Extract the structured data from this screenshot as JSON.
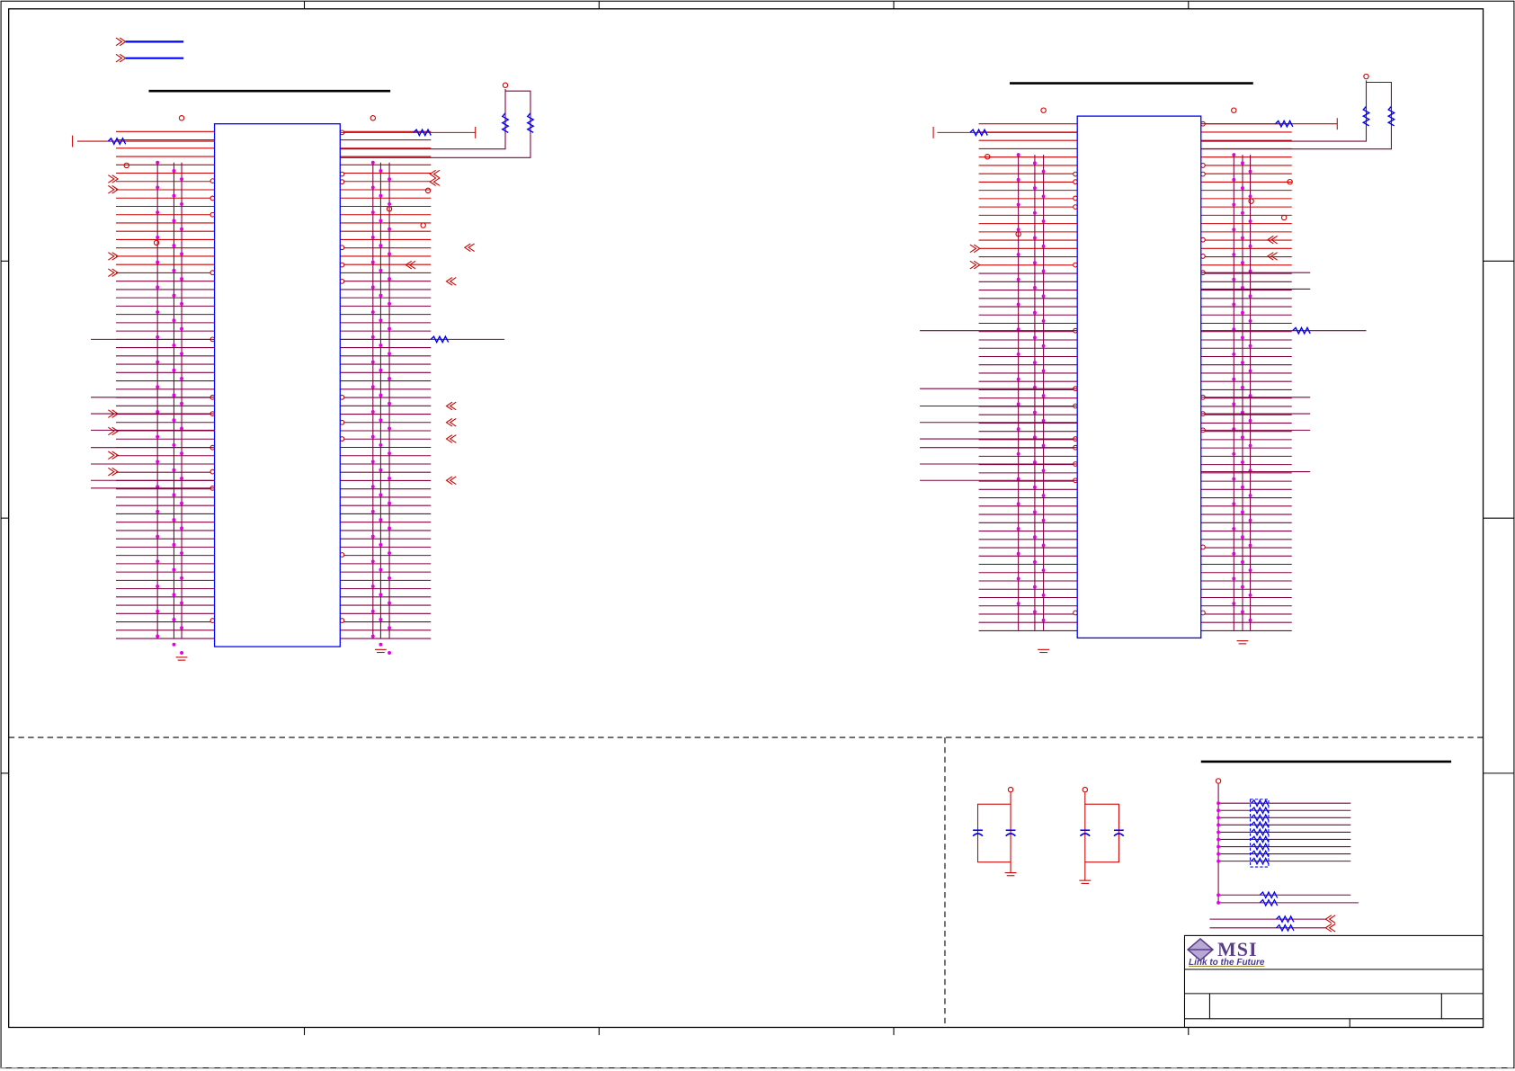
{
  "logo": {
    "brand": "MSI",
    "tagline": "Link to the Future"
  },
  "colors": {
    "wire": "#cc0000",
    "bus": "#800040",
    "chip": "#0000ff",
    "junction": "#e000e0",
    "frame": "#000000",
    "logo": "#5a3d8a"
  }
}
